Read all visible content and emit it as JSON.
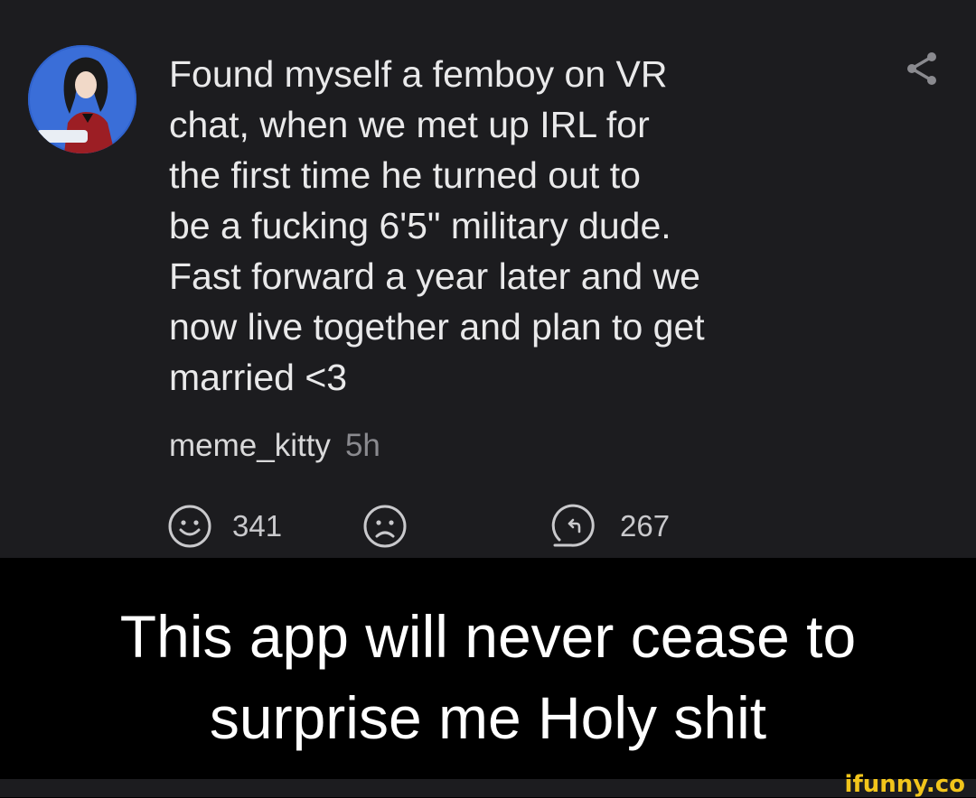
{
  "post": {
    "text": "Found myself a femboy on VR\nchat, when we met up IRL for\nthe first time he turned out to\nbe a fucking 6'5\" military dude.\nFast forward a year later and we\nnow live together and plan to get\nmarried <3",
    "author": "meme_kitty",
    "time": "5h",
    "upvotes": "341",
    "replies": "267"
  },
  "caption": "This app will never cease to\nsurprise me Holy shit",
  "watermark": "ifunny.co",
  "icons": {
    "avatar": "avatar",
    "share": "share-icon",
    "upvote": "smile-icon",
    "downvote": "frown-icon",
    "reply": "reply-icon"
  },
  "colors": {
    "post_bg": "#1c1c1f",
    "text": "#e9e9ea",
    "muted": "#8a8a8f",
    "watermark": "#f2c51b"
  }
}
